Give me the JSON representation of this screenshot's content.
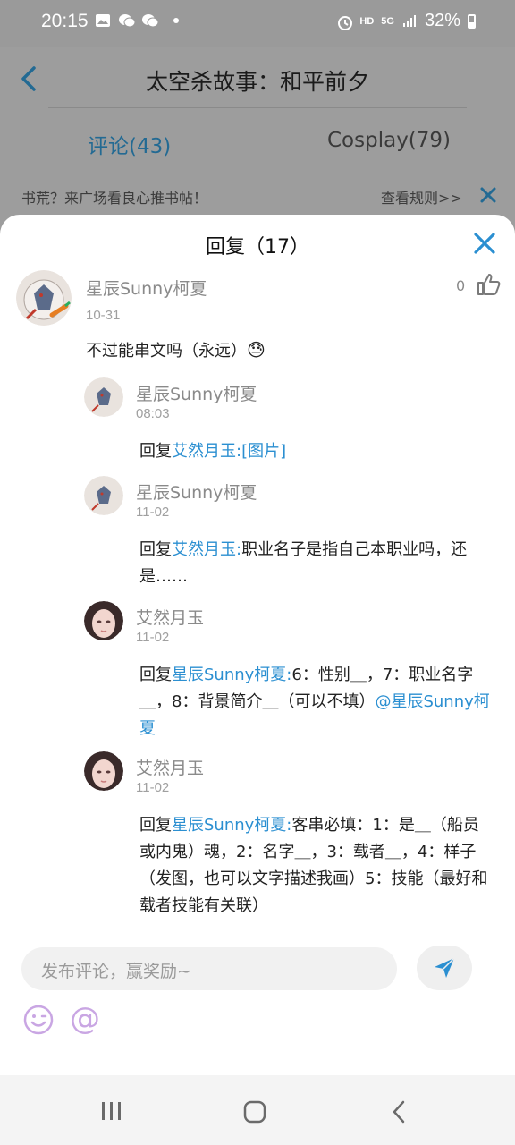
{
  "status_bar": {
    "time": "20:15",
    "hd": "HD",
    "network": "5G",
    "battery": "32%"
  },
  "background_page": {
    "title": "太空杀故事：和平前夕",
    "tabs": [
      "评论(43)",
      "Cosplay(79)"
    ],
    "notice": "书荒？来广场看良心推书帖！",
    "rules_link": "查看规则>>"
  },
  "sheet": {
    "title": "回复（17）",
    "main_comment": {
      "author": "星辰Sunny柯夏",
      "date": "10-31",
      "text": "不过能串文吗（永远）",
      "emoji": "😓",
      "likes": "0"
    },
    "replies": [
      {
        "author": "星辰Sunny柯夏",
        "date": "08:03",
        "prefix": "回复",
        "target": "艾然月玉:",
        "text": "[图片]",
        "text_is_link": true
      },
      {
        "author": "星辰Sunny柯夏",
        "date": "11-02",
        "prefix": "回复",
        "target": "艾然月玉:",
        "text": "职业名子是指自己本职业吗，还是……"
      },
      {
        "author": "艾然月玉",
        "date": "11-02",
        "prefix": "回复",
        "target": "星辰Sunny柯夏:",
        "text": "6：性别＿，7：职业名字＿，8：背景简介＿（可以不填）",
        "mention": "@星辰Sunny柯夏"
      },
      {
        "author": "艾然月玉",
        "date": "11-02",
        "prefix": "回复",
        "target": "星辰Sunny柯夏:",
        "text": "客串必填：1：是＿（船员或内鬼）魂，2：名字＿，3：载者＿，4：样子（发图，也可以文字描述我画）5：技能（最好和载者技能有关联）"
      }
    ]
  },
  "composer": {
    "placeholder": "发布评论，赢奖励~",
    "at_symbol": "@"
  },
  "colors": {
    "accent": "#2b8fd1",
    "overlay": "#9d9d9d",
    "emoji_purple": "#c9a6e3"
  },
  "icons": [
    "back-icon",
    "close-icon",
    "like-icon",
    "send-icon",
    "emoji-icon",
    "at-icon",
    "recents-icon",
    "home-icon",
    "nav-back-icon"
  ]
}
